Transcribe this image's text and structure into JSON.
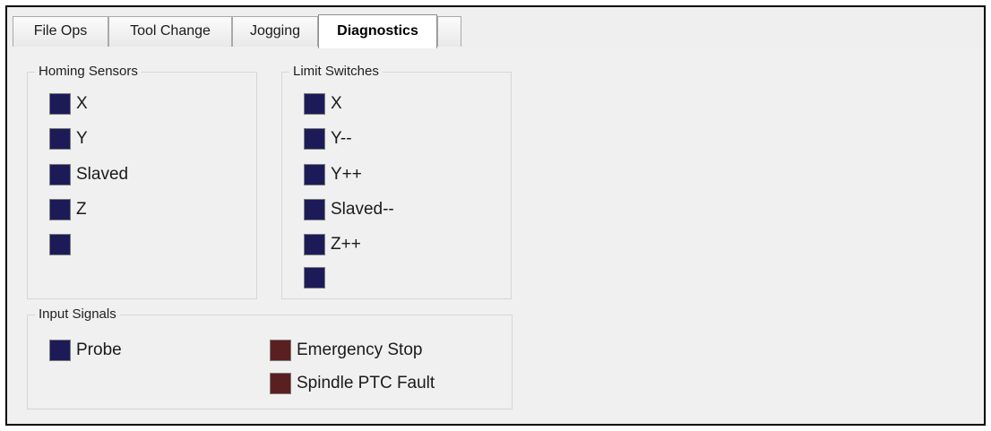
{
  "tabs": [
    {
      "label": "File Ops",
      "active": false
    },
    {
      "label": "Tool Change",
      "active": false
    },
    {
      "label": "Jogging",
      "active": false
    },
    {
      "label": "Diagnostics",
      "active": true
    },
    {
      "label": "",
      "active": false
    }
  ],
  "homing_sensors": {
    "title": "Homing Sensors",
    "items": [
      {
        "label": "X",
        "state": "off",
        "color": "#1c1b58"
      },
      {
        "label": "Y",
        "state": "off",
        "color": "#1c1b58"
      },
      {
        "label": "Slaved",
        "state": "off",
        "color": "#1c1b58"
      },
      {
        "label": "Z",
        "state": "off",
        "color": "#1c1b58"
      },
      {
        "label": "",
        "state": "off",
        "color": "#1c1b58"
      }
    ]
  },
  "limit_switches": {
    "title": "Limit Switches",
    "items": [
      {
        "label": "X",
        "state": "off",
        "color": "#1c1b58"
      },
      {
        "label": "Y--",
        "state": "off",
        "color": "#1c1b58"
      },
      {
        "label": "Y++",
        "state": "off",
        "color": "#1c1b58"
      },
      {
        "label": "Slaved--",
        "state": "off",
        "color": "#1c1b58"
      },
      {
        "label": "Z++",
        "state": "off",
        "color": "#1c1b58"
      },
      {
        "label": "",
        "state": "off",
        "color": "#1c1b58"
      }
    ]
  },
  "input_signals": {
    "title": "Input Signals",
    "items": [
      {
        "label": "Probe",
        "state": "off",
        "color": "#1c1b58"
      },
      {
        "label": "Emergency Stop",
        "state": "off",
        "color": "#5a1f20"
      },
      {
        "label": "Spindle PTC Fault",
        "state": "off",
        "color": "#5a1f20"
      }
    ]
  }
}
